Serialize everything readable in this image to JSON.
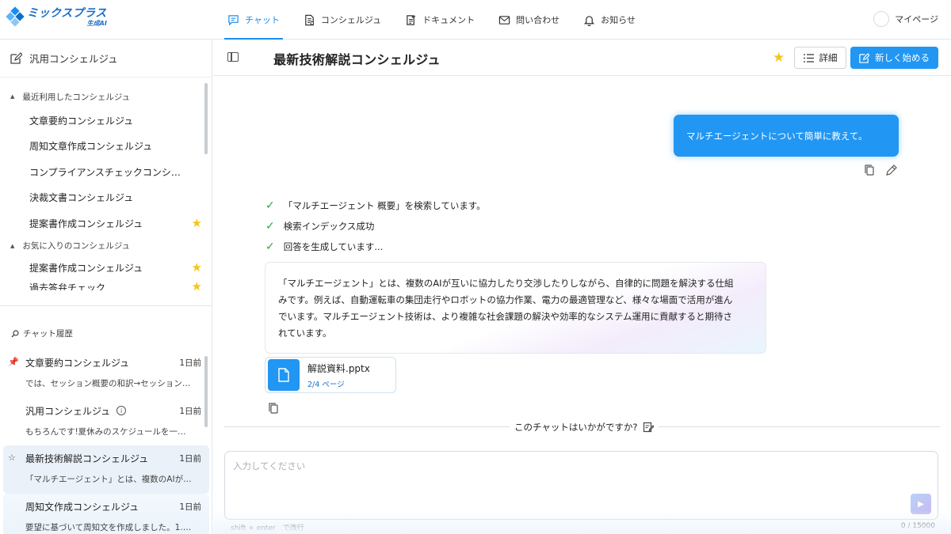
{
  "brand": {
    "name": "ミックスプラス",
    "sub": "生成AI"
  },
  "nav": {
    "items": [
      {
        "label": "チャット",
        "icon": "chat-icon",
        "active": true
      },
      {
        "label": "コンシェルジュ",
        "icon": "concierge-icon",
        "active": false
      },
      {
        "label": "ドキュメント",
        "icon": "document-icon",
        "active": false
      },
      {
        "label": "問い合わせ",
        "icon": "mail-icon",
        "active": false
      },
      {
        "label": "お知らせ",
        "icon": "bell-icon",
        "active": false
      }
    ],
    "mypage": "マイページ"
  },
  "sidebar": {
    "general": "汎用コンシェルジュ",
    "recent_title": "最近利用したコンシェルジュ",
    "recent": [
      {
        "label": "文章要約コンシェルジュ",
        "starred": false
      },
      {
        "label": "周知文章作成コンシェルジュ",
        "starred": false
      },
      {
        "label": "コンプライアンスチェックコンシ…",
        "starred": false
      },
      {
        "label": "決裁文書コンシェルジュ",
        "starred": false
      },
      {
        "label": "提案書作成コンシェルジュ",
        "starred": true
      }
    ],
    "favorites_title": "お気に入りのコンシェルジュ",
    "favorites": [
      {
        "label": "提案書作成コンシェルジュ",
        "starred": true
      },
      {
        "label": "過去答弁チェック",
        "starred": true
      }
    ],
    "history_title": "チャット履歴",
    "history": [
      {
        "title": "文章要約コンシェルジュ",
        "time": "1日前",
        "snippet": "では、セッション概要の和訳→セッションの…",
        "pinned": true
      },
      {
        "title": "汎用コンシェルジュ",
        "time": "1日前",
        "snippet": "もちろんです!夏休みのスケジュールを一緒に…",
        "info": true
      },
      {
        "title": "最新技術解説コンシェルジュ",
        "time": "1日前",
        "snippet": "「マルチエージェント」とは、複数のAIが互い…",
        "active": true
      },
      {
        "title": "周知文作成コンシェルジュ",
        "time": "1日前",
        "snippet": "要望に基づいて周知文を作成しました。1.概…"
      }
    ]
  },
  "main": {
    "title": "最新技術解説コンシェルジュ",
    "detail_label": "詳細",
    "new_label": "新しく始める",
    "user_message": "マルチエージェントについて簡単に教えて。",
    "steps": [
      "「マルチエージェント 概要」を検索しています。",
      "検索インデックス成功",
      "回答を生成しています..."
    ],
    "answer_lines": [
      "「マルチエージェント」とは、複数のAIが互いに協力したり交渉したりしながら、自律的に問題を解決する仕組",
      "みです。例えば、自動運転車の集団走行やロボットの協力作業、電力の最適管理など、様々な場面で活用が進ん",
      "でいます。マルチエージェント技術は、より複雑な社会課題の解決や効率的なシステム運用に貢献すると期待さ",
      "れています。"
    ],
    "file": {
      "name": "解説資料.pptx",
      "meta": "2/4 ページ"
    },
    "feedback": "このチャットはいかがですか?",
    "input_placeholder": "入力してください",
    "hint": "shift + enter　で改行",
    "counter": "0 / 15000"
  },
  "colors": {
    "accent": "#2196f3",
    "star": "#f5c518",
    "check": "#2ea44f"
  }
}
